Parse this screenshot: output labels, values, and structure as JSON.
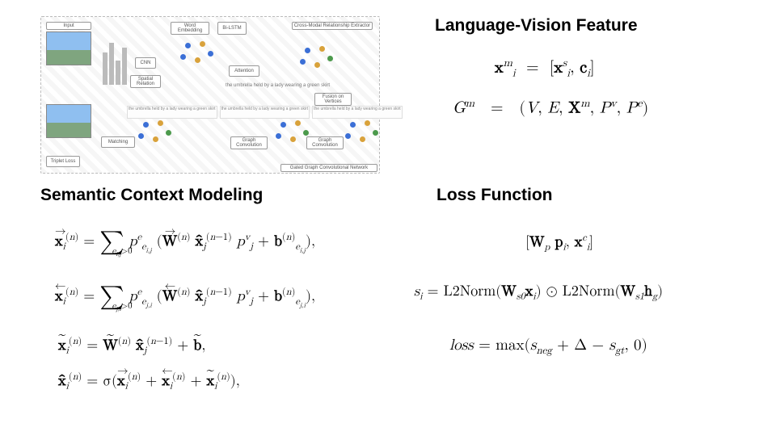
{
  "headings": {
    "lang_vis": "Language-Vision  Feature",
    "sem_ctx": "Semantic  Context  Modeling",
    "loss_fn": "Loss  Function"
  },
  "diagram": {
    "labels": {
      "input": "Input",
      "word_embedding": "Word Embedding",
      "bilstm": "Bi-LSTM",
      "cnn": "CNN",
      "spatial": "Spatial Relation",
      "attention": "Attention",
      "extractor": "Cross-Modal Relationship Extractor",
      "fusion": "Fusion on Vertices",
      "graph_conv": "Graph Convolution",
      "graph_conv2": "Graph Convolution",
      "matching": "Matching",
      "triplet": "Triplet Loss",
      "gcn": "Gated Graph Convolutional Network"
    },
    "caption_phrase": "the umbrella held by a lady wearing a green skirt"
  },
  "formulas": {
    "lv1_lhs": "x",
    "lv1_lhs_sup": "m",
    "lv1_lhs_sub": "i",
    "lv1_rhs_a": "x",
    "lv1_rhs_a_sup": "s",
    "lv1_rhs_a_sub": "i",
    "lv1_rhs_b": "c",
    "lv1_rhs_b_sub": "i",
    "lv2_G": "G",
    "lv2_G_sup": "m",
    "lv2_tuple_V": "V",
    "lv2_tuple_E": "E",
    "lv2_tuple_X": "X",
    "lv2_tuple_X_sup": "m",
    "lv2_tuple_Pv": "P",
    "lv2_tuple_Pv_sup": "v",
    "lv2_tuple_Pe": "P",
    "lv2_tuple_Pe_sup": "e",
    "sc_sum_cond1": "e_{i,j} > 0",
    "sc_sum_cond2": "e_{j,i} > 0",
    "ls1_W": "W",
    "ls1_W_sub": "p",
    "ls1_p": "p",
    "ls1_p_sub": "i",
    "ls1_x": "x",
    "ls1_x_sup": "c",
    "ls1_x_sub": "i",
    "ls2_s": "s",
    "ls2_s_sub": "i",
    "ls2_fn": "L2Norm",
    "ls2_W0": "W",
    "ls2_W0_sub": "s0",
    "ls2_x": "x",
    "ls2_x_sub": "i",
    "ls2_W1": "W",
    "ls2_W1_sub": "s1",
    "ls2_h": "h",
    "ls2_h_sub": "g",
    "ls3_word": "loss",
    "ls3_max": "max",
    "ls3_sneg": "s",
    "ls3_sneg_sub": "neg",
    "ls3_delta": "Δ",
    "ls3_sgt": "s",
    "ls3_sgt_sub": "gt"
  }
}
